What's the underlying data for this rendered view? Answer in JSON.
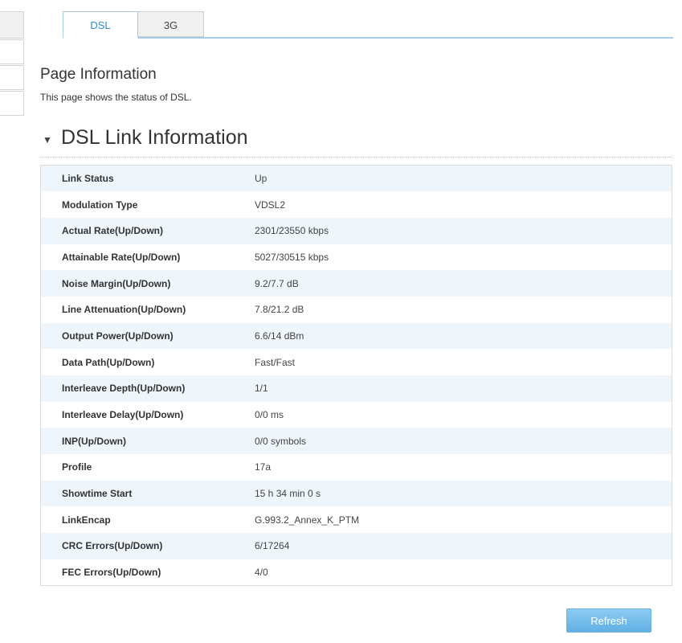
{
  "tabs": [
    {
      "label": "DSL",
      "active": true
    },
    {
      "label": "3G",
      "active": false
    }
  ],
  "page_info": {
    "title": "Page Information",
    "description": "This page shows the status of DSL."
  },
  "section": {
    "title": "DSL Link Information",
    "expanded": true
  },
  "rows": [
    {
      "label": "Link Status",
      "value": "Up"
    },
    {
      "label": "Modulation Type",
      "value": "VDSL2"
    },
    {
      "label": "Actual Rate(Up/Down)",
      "value": "2301/23550 kbps"
    },
    {
      "label": "Attainable Rate(Up/Down)",
      "value": "5027/30515 kbps"
    },
    {
      "label": "Noise Margin(Up/Down)",
      "value": "9.2/7.7 dB"
    },
    {
      "label": "Line Attenuation(Up/Down)",
      "value": "7.8/21.2 dB"
    },
    {
      "label": "Output Power(Up/Down)",
      "value": "6.6/14 dBm"
    },
    {
      "label": "Data Path(Up/Down)",
      "value": "Fast/Fast"
    },
    {
      "label": "Interleave Depth(Up/Down)",
      "value": "1/1"
    },
    {
      "label": "Interleave Delay(Up/Down)",
      "value": "0/0 ms"
    },
    {
      "label": "INP(Up/Down)",
      "value": "0/0 symbols"
    },
    {
      "label": "Profile",
      "value": "17a"
    },
    {
      "label": "Showtime Start",
      "value": "15 h 34 min 0 s"
    },
    {
      "label": "LinkEncap",
      "value": "G.993.2_Annex_K_PTM"
    },
    {
      "label": "CRC Errors(Up/Down)",
      "value": "6/17264"
    },
    {
      "label": "FEC Errors(Up/Down)",
      "value": "4/0"
    }
  ],
  "buttons": {
    "refresh_label": "Refresh"
  },
  "colors": {
    "accent": "#2f8dcc",
    "tab_border": "#a8cbe4",
    "row_stripe": "#eef5fb",
    "button": "#6ab2e0"
  }
}
